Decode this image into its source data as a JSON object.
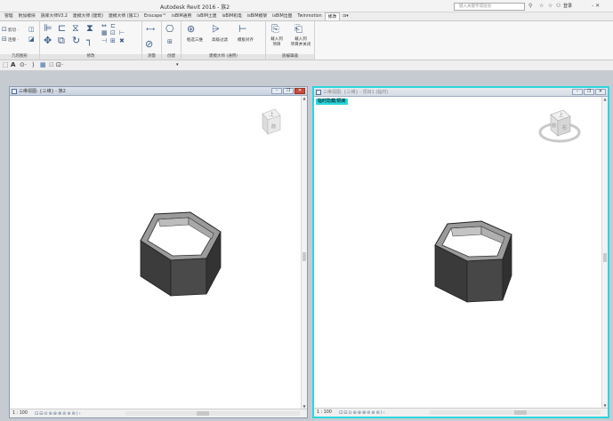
{
  "window": {
    "title": "Autodesk Revit 2016 -   族2",
    "search_placeholder": "键入关键字或短语",
    "user": "登录",
    "controls": "- ✕"
  },
  "ribbon": {
    "tabs": [
      "管理",
      "附加模块",
      "族库大师V3.2",
      "建模大师 (建筑)",
      "建模大师 (施工)",
      "Enscape™",
      "isBIM通用",
      "isBIM土建",
      "isBIM机电",
      "isBIM模架",
      "isBIM出图",
      "Twinmotion",
      "修改",
      "⊡▾"
    ],
    "active_tab": "修改",
    "groups": [
      {
        "label": "几何图形"
      },
      {
        "label": "修改"
      },
      {
        "label": "测量"
      },
      {
        "label": "创建"
      },
      {
        "label": "建模大师 (通用)",
        "buttons": [
          {
            "label": "框选三维"
          },
          {
            "label": "高级过滤"
          },
          {
            "label": "模板对齐"
          }
        ]
      },
      {
        "label": "族编辑器",
        "buttons": [
          {
            "label": "载入到\n项目"
          },
          {
            "label": "载入到\n项目并关闭"
          }
        ]
      }
    ],
    "left_labels": [
      "剪切 · ",
      "连接 · "
    ]
  },
  "quick_access": {
    "items": [
      "A",
      "⊙·",
      "⟩",
      "▦",
      "⊡",
      "⊡·"
    ],
    "dropdown": "▾"
  },
  "views": {
    "left": {
      "title": "三维视图: {三维} - 族2",
      "scale": "1 : 100",
      "status_icons": "⊡⊟⊙⊛⊕⊗⊘⊚⊜⟩‹"
    },
    "right": {
      "title": "三维视图: {三维} - 项目1 (临时)",
      "temp_label": "临时隐藏/隔离",
      "scale": "1 : 100",
      "status_icons": "⊡⊟⊙⊛⊕⊗⊘⊚⊜⟩‹"
    }
  },
  "viewcube": {
    "left": {
      "top": "上",
      "front": "前"
    },
    "right": {
      "top": "上",
      "front": "前",
      "right": "右"
    }
  },
  "colors": {
    "active_view_border": "#2ad7de",
    "wall_dark": "#3c3c3c",
    "wall_light": "#909090"
  }
}
